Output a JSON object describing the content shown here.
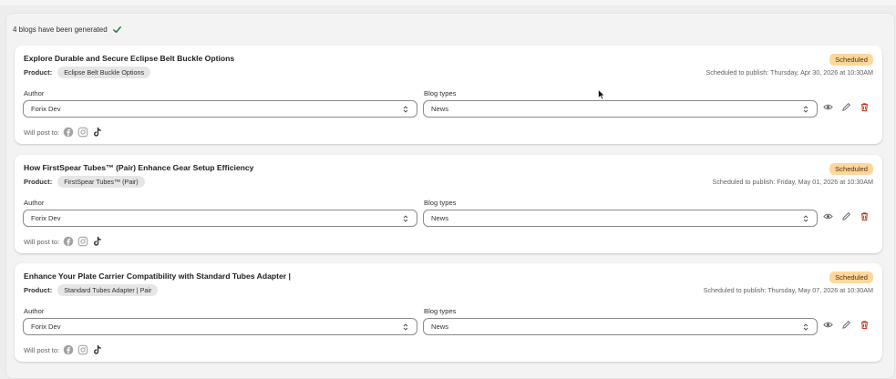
{
  "status": {
    "text": "4 blogs have been generated"
  },
  "field_labels": {
    "author": "Author",
    "blog_types": "Blog types"
  },
  "will_post_label": "Will post to:",
  "product_label": "Product:",
  "social_icons": [
    "facebook-icon",
    "instagram-icon",
    "tiktok-icon"
  ],
  "action_icons": [
    "eye-icon",
    "pencil-icon",
    "trash-icon"
  ],
  "colors": {
    "badge_bg": "#ffd79d",
    "badge_text": "#4f3303",
    "delete_red": "#c5280c",
    "check_green": "#1a7f37"
  },
  "cards": [
    {
      "title": "Explore Durable and Secure Eclipse Belt Buckle Options",
      "product": "Eclipse Belt Buckle Options",
      "badge": "Scheduled",
      "schedule": "Scheduled to publish: Thursday, Apr 30, 2026 at 10:30AM",
      "author": "Forix Dev",
      "blog_type": "News"
    },
    {
      "title": "How FirstSpear Tubes™ (Pair) Enhance Gear Setup Efficiency",
      "product": "FirstSpear Tubes™ (Pair)",
      "badge": "Scheduled",
      "schedule": "Scheduled to publish: Friday, May 01, 2026 at 10:30AM",
      "author": "Forix Dev",
      "blog_type": "News"
    },
    {
      "title": "Enhance Your Plate Carrier Compatibility with Standard Tubes Adapter |",
      "product": "Standard Tubes Adapter | Pair",
      "badge": "Scheduled",
      "schedule": "Scheduled to publish: Thursday, May 07, 2026 at 10:30AM",
      "author": "Forix Dev",
      "blog_type": "News"
    }
  ]
}
